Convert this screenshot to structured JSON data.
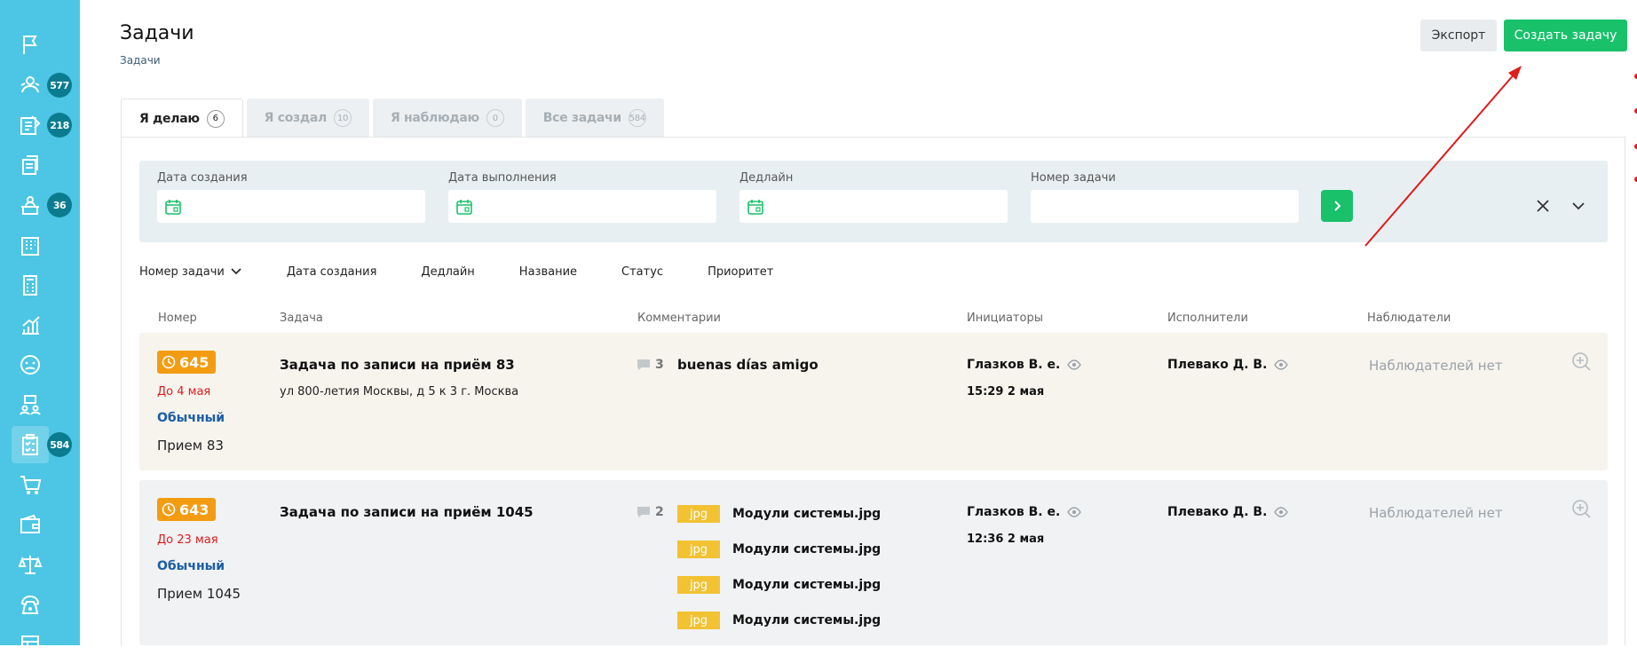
{
  "sidebar": {
    "items": [
      {
        "icon": "flag-icon",
        "badge": ""
      },
      {
        "icon": "users-group-icon",
        "badge": "577"
      },
      {
        "icon": "edit-note-icon",
        "badge": "218"
      },
      {
        "icon": "documents-icon",
        "badge": ""
      },
      {
        "icon": "reception-icon",
        "badge": "36"
      },
      {
        "icon": "building-icon",
        "badge": ""
      },
      {
        "icon": "calculator-icon",
        "badge": ""
      },
      {
        "icon": "chart-growth-icon",
        "badge": ""
      },
      {
        "icon": "sad-face-icon",
        "badge": ""
      },
      {
        "icon": "team-icon",
        "badge": ""
      },
      {
        "icon": "tasks-icon",
        "badge": "584"
      },
      {
        "icon": "cart-icon",
        "badge": ""
      },
      {
        "icon": "wallet-icon",
        "badge": ""
      },
      {
        "icon": "scales-icon",
        "badge": ""
      },
      {
        "icon": "phone-icon",
        "badge": ""
      },
      {
        "icon": "table-icon",
        "badge": ""
      }
    ]
  },
  "header": {
    "title": "Задачи",
    "breadcrumb": "Задачи",
    "export_label": "Экспорт",
    "create_label": "Создать задачу"
  },
  "tabs": [
    {
      "label": "Я делаю",
      "count": "6"
    },
    {
      "label": "Я создал",
      "count": "10"
    },
    {
      "label": "Я наблюдаю",
      "count": "0"
    },
    {
      "label": "Все задачи",
      "count": "584"
    }
  ],
  "filters": {
    "created_label": "Дата создания",
    "done_label": "Дата выполнения",
    "deadline_label": "Дедлайн",
    "number_label": "Номер задачи"
  },
  "sort": {
    "number": "Номер задачи",
    "created": "Дата создания",
    "deadline": "Дедлайн",
    "name": "Название",
    "status": "Статус",
    "priority": "Приоритет"
  },
  "columns": {
    "number": "Номер",
    "task": "Задача",
    "comments": "Комментарии",
    "initiators": "Инициаторы",
    "executors": "Исполнители",
    "observers": "Наблюдатели"
  },
  "tasks": [
    {
      "number": "645",
      "due": "До 4 мая",
      "priority": "Обычный",
      "appointment": "Прием 83",
      "title": "Задача по записи на приём 83",
      "address": "ул 800-летия Москвы, д 5 к 3 г. Москва",
      "comment_count": "3",
      "comment": "buenas días amigo",
      "initiator": "Глазков В. е.",
      "time": "15:29",
      "date": "2 мая",
      "executor": "Плевако Д. В.",
      "observers": "Наблюдателей нет"
    },
    {
      "number": "643",
      "due": "До 23 мая",
      "priority": "Обычный",
      "appointment": "Прием 1045",
      "title": "Задача по записи на приём 1045",
      "comment_count": "2",
      "files": [
        {
          "type": "jpg",
          "name": "Модули системы.jpg"
        },
        {
          "type": "jpg",
          "name": "Модули системы.jpg"
        },
        {
          "type": "jpg",
          "name": "Модули системы.jpg"
        },
        {
          "type": "jpg",
          "name": "Модули системы.jpg"
        }
      ],
      "initiator": "Глазков В. е.",
      "time": "12:36",
      "date": "2 мая",
      "executor": "Плевако Д. В.",
      "observers": "Наблюдателей нет"
    }
  ],
  "colors": {
    "sidebar": "#4cc6e4",
    "accent_green": "#19c16a",
    "badge_orange": "#f39c12",
    "due_red": "#e01b1b",
    "priority_blue": "#1a5ea5",
    "file_yellow": "#f2c233",
    "annotation_arrow": "#e01b1b"
  }
}
